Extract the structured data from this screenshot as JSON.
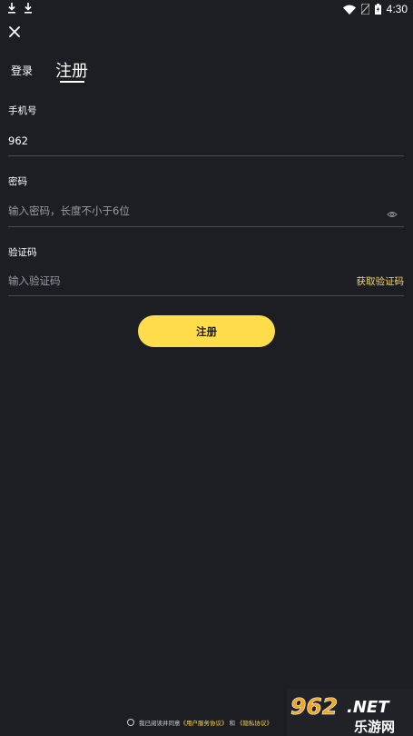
{
  "status_bar": {
    "time": "4:30",
    "left_icons": [
      "download-icon",
      "download-icon"
    ],
    "right_icons": [
      "wifi-icon",
      "no-sim-icon",
      "battery-icon"
    ]
  },
  "tabs": {
    "login": "登录",
    "register": "注册",
    "active": "register"
  },
  "form": {
    "phone": {
      "label": "手机号",
      "value": "962"
    },
    "password": {
      "label": "密码",
      "placeholder": "输入密码，长度不小于6位"
    },
    "code": {
      "label": "验证码",
      "placeholder": "输入验证码",
      "get_code": "获取验证码"
    },
    "submit": "注册"
  },
  "agreement": {
    "prefix": "我已阅读并同意",
    "user_agreement": "《用户服务协议》",
    "and": "和",
    "privacy": "《隐私协议》"
  },
  "watermark": {
    "text_top": "962.NET",
    "text_bottom": "乐游网"
  },
  "colors": {
    "background": "#1d1e24",
    "accent": "#ffdc4a",
    "divider": "#4a4b52"
  }
}
